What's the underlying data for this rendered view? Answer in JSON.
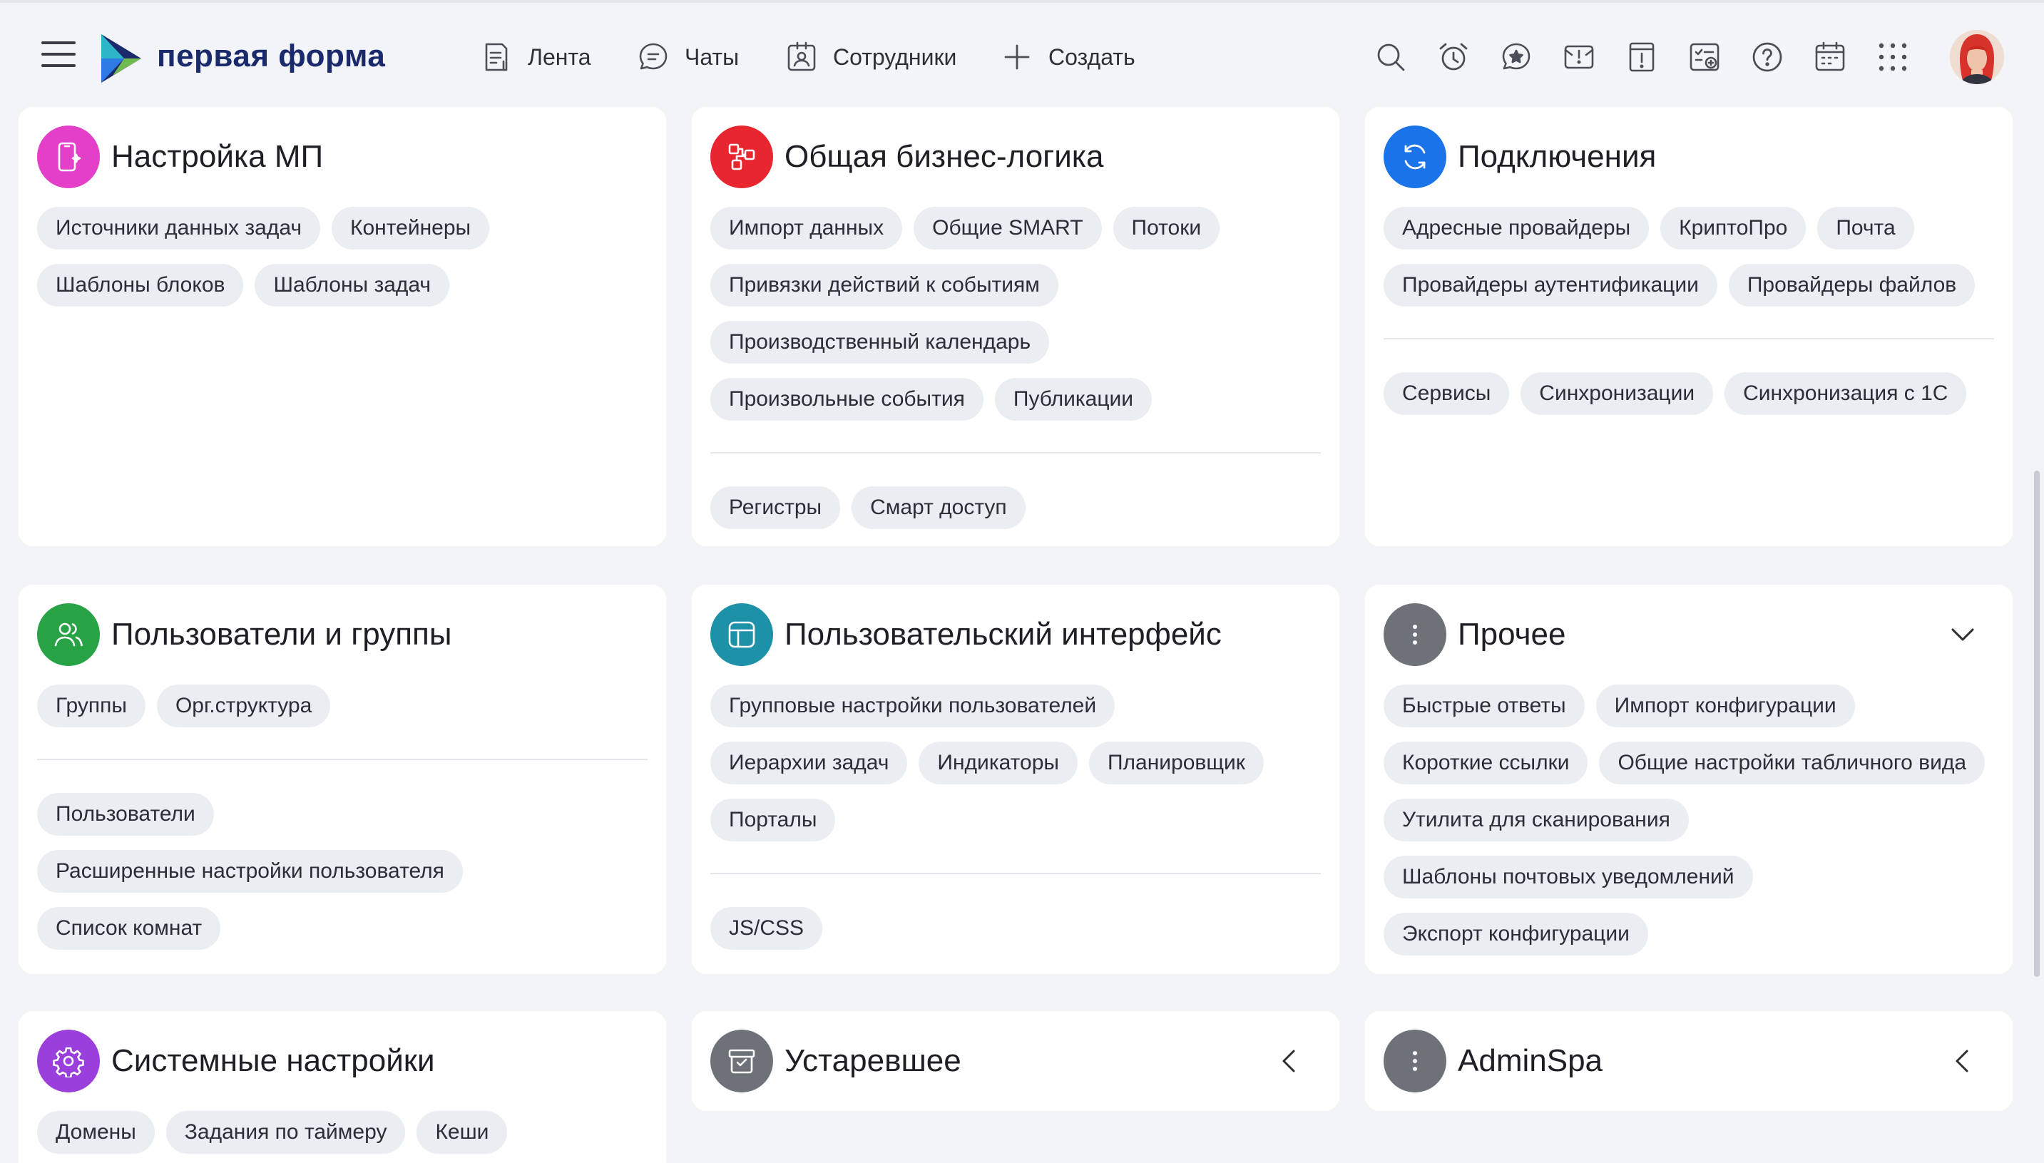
{
  "header": {
    "logo": "первая форма",
    "nav": [
      {
        "label": "Лента",
        "icon": "feed-icon"
      },
      {
        "label": "Чаты",
        "icon": "chat-icon"
      },
      {
        "label": "Сотрудники",
        "icon": "employees-icon"
      },
      {
        "label": "Создать",
        "icon": "plus-icon"
      }
    ],
    "tools": [
      "search-icon",
      "alarm-icon",
      "favorites-icon",
      "alert-mail-icon",
      "notice-icon",
      "tasks-icon",
      "help-icon",
      "calendar-icon",
      "apps-grid-icon"
    ]
  },
  "colors": {
    "mp": "#e33fc9",
    "business": "#e8262f",
    "connections": "#1a73e8",
    "users": "#27a346",
    "ui": "#1c91a8",
    "other": "#6d7178",
    "system": "#9b3fdc",
    "legacy": "#6d7178",
    "adminspa": "#6d7178"
  },
  "cards": {
    "mp": {
      "title": "Настройка МП",
      "chips": [
        "Источники данных задач",
        "Контейнеры",
        "Шаблоны блоков",
        "Шаблоны задач"
      ]
    },
    "business": {
      "title": "Общая бизнес-логика",
      "chips": [
        "Импорт данных",
        "Общие SMART",
        "Потоки",
        "Привязки действий к событиям",
        "Производственный календарь",
        "Произвольные события",
        "Публикации"
      ],
      "chips2": [
        "Регистры",
        "Смарт доступ"
      ]
    },
    "connections": {
      "title": "Подключения",
      "chips": [
        "Адресные провайдеры",
        "КриптоПро",
        "Почта",
        "Провайдеры аутентификации",
        "Провайдеры файлов"
      ],
      "chips2": [
        "Сервисы",
        "Синхронизации",
        "Синхронизация с 1С"
      ]
    },
    "users": {
      "title": "Пользователи и группы",
      "chips": [
        "Группы",
        "Орг.структура"
      ],
      "chips2": [
        "Пользователи",
        "Расширенные настройки пользователя",
        "Список комнат"
      ]
    },
    "ui": {
      "title": "Пользовательский интерфейс",
      "chips": [
        "Групповые настройки пользователей",
        "Иерархии задач",
        "Индикаторы",
        "Планировщик",
        "Порталы"
      ],
      "chips2": [
        "JS/CSS"
      ]
    },
    "other": {
      "title": "Прочее",
      "chips": [
        "Быстрые ответы",
        "Импорт конфигурации",
        "Короткие ссылки",
        "Общие настройки табличного вида",
        "Утилита для сканирования",
        "Шаблоны почтовых уведомлений",
        "Экспорт конфигурации"
      ]
    },
    "system": {
      "title": "Системные настройки",
      "chips": [
        "Домены",
        "Задания по таймеру",
        "Кеши"
      ]
    },
    "legacy": {
      "title": "Устаревшее"
    },
    "adminspa": {
      "title": "AdminSpa"
    }
  }
}
